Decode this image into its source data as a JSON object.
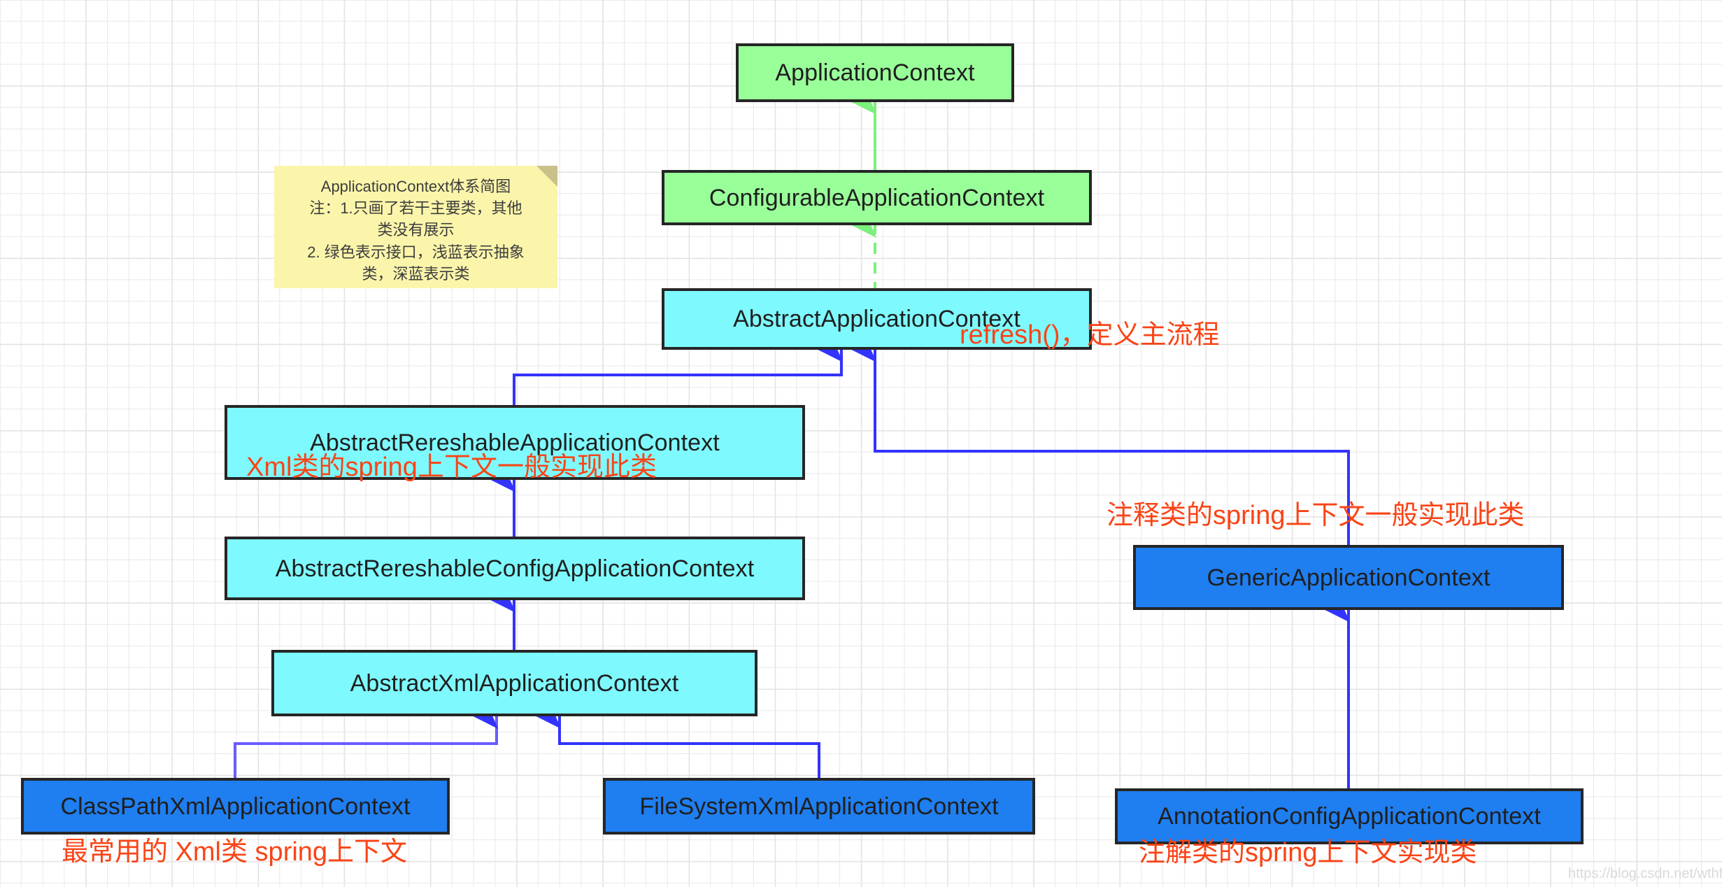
{
  "diagram": {
    "title_note": {
      "lines": [
        "ApplicationContext体系简图",
        "注：1.只画了若干主要类，其他",
        "类没有展示",
        "2. 绿色表示接口，浅蓝表示抽象",
        "类，深蓝表示类"
      ],
      "fill_color": "#fbf5ab"
    },
    "legend_colors": {
      "interface": "#99ff99",
      "abstract_class": "#7efaff",
      "concrete_class": "#1f7ef0",
      "annotation_text": "#fa4416",
      "inheritance_arrow": "#3333ff",
      "realization_arrow": "#7cf07c"
    },
    "nodes": [
      {
        "id": "applicationContext",
        "label": "ApplicationContext",
        "kind": "interface"
      },
      {
        "id": "configurableApplicationContext",
        "label": "ConfigurableApplicationContext",
        "kind": "interface"
      },
      {
        "id": "abstractApplicationContext",
        "label": "AbstractApplicationContext",
        "kind": "abstract"
      },
      {
        "id": "abstractRereshableApplicationContext",
        "label": "AbstractRereshableApplicationContext",
        "kind": "abstract"
      },
      {
        "id": "abstractRereshableConfigApplicationContext",
        "label": "AbstractRereshableConfigApplicationContext",
        "kind": "abstract"
      },
      {
        "id": "abstractXmlApplicationContext",
        "label": "AbstractXmlApplicationContext",
        "kind": "abstract"
      },
      {
        "id": "classPathXmlApplicationContext",
        "label": "ClassPathXmlApplicationContext",
        "kind": "class"
      },
      {
        "id": "fileSystemXmlApplicationContext",
        "label": "FileSystemXmlApplicationContext",
        "kind": "class"
      },
      {
        "id": "genericApplicationContext",
        "label": "GenericApplicationContext",
        "kind": "class"
      },
      {
        "id": "annotationConfigApplicationContext",
        "label": "AnnotationConfigApplicationContext",
        "kind": "class"
      }
    ],
    "annotations": [
      {
        "id": "refresh",
        "text": "refresh()，定义主流程"
      },
      {
        "id": "xml-impl",
        "text": "Xml类的spring上下文一般实现此类"
      },
      {
        "id": "annotation-impl",
        "text": "注释类的spring上下文一般实现此类"
      },
      {
        "id": "classpath-caption",
        "text": "最常用的 Xml类 spring上下文"
      },
      {
        "id": "annotationcfg-caption",
        "text": "注解类的spring上下文实现类"
      }
    ],
    "watermark": "https://blog.csdn.net/wthfeng"
  }
}
